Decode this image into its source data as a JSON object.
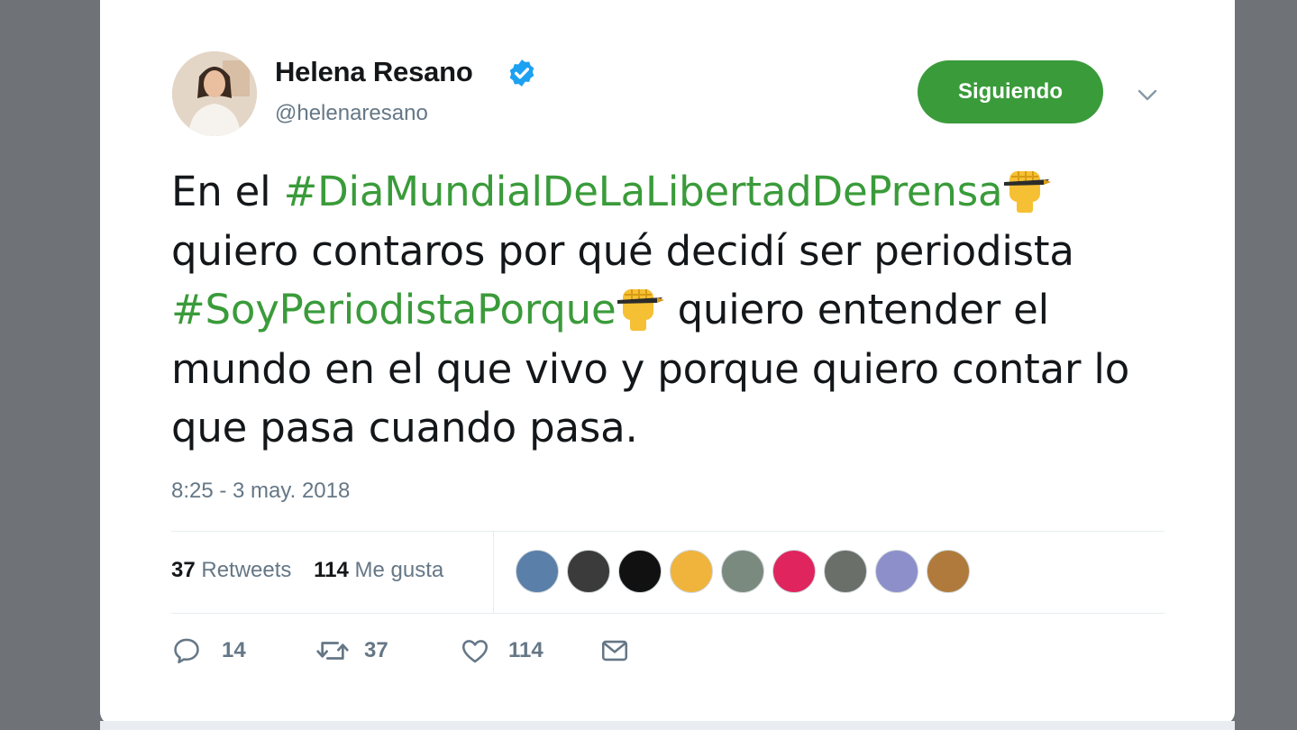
{
  "author": {
    "name": "Helena Resano",
    "handle": "@helenaresano",
    "verified": true
  },
  "follow_button": {
    "label": "Siguiendo"
  },
  "tweet": {
    "segments": [
      {
        "type": "text",
        "value": "En el "
      },
      {
        "type": "hashtag",
        "value": "#DiaMundialDeLaLibertadDePrensa"
      },
      {
        "type": "emoji",
        "value": "raised-fist-pen"
      },
      {
        "type": "text",
        "value": " quiero contaros por qué decidí ser periodista "
      },
      {
        "type": "hashtag",
        "value": "#SoyPeriodistaPorque"
      },
      {
        "type": "emoji",
        "value": "raised-fist-pen"
      },
      {
        "type": "text",
        "value": " quiero entender el mundo en el que vivo y porque quiero contar lo que pasa cuando pasa."
      }
    ],
    "timestamp": "8:25 - 3 may. 2018"
  },
  "stats": {
    "retweets_count": "37",
    "retweets_label": "Retweets",
    "likes_count": "114",
    "likes_label": "Me gusta"
  },
  "likers": [
    {
      "name": "liker-avatar-1",
      "color": "#5a7fa8"
    },
    {
      "name": "liker-avatar-2",
      "color": "#3b3b3b"
    },
    {
      "name": "liker-avatar-3",
      "color": "#111111"
    },
    {
      "name": "liker-avatar-4",
      "color": "#f0b43c"
    },
    {
      "name": "liker-avatar-5",
      "color": "#7b8a7e"
    },
    {
      "name": "liker-avatar-6",
      "color": "#e0245e"
    },
    {
      "name": "liker-avatar-7",
      "color": "#6a6f6a"
    },
    {
      "name": "liker-avatar-8",
      "color": "#8c8fc9"
    },
    {
      "name": "liker-avatar-9",
      "color": "#b07a3c"
    }
  ],
  "actions": {
    "reply_count": "14",
    "retweet_count": "37",
    "like_count": "114"
  },
  "colors": {
    "accent": "#3a9b3a",
    "text": "#14171a",
    "muted": "#657786",
    "verified": "#1da1f2"
  }
}
